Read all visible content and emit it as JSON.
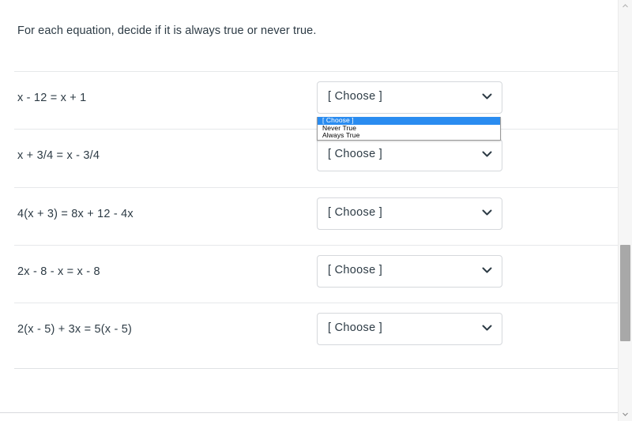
{
  "prompt": "For each equation, decide if it is always true or never true.",
  "select_placeholder": "[ Choose ]",
  "colors": {
    "highlight": "#2a8cf0",
    "text": "#2d3b45",
    "border": "#d5d8dc",
    "divider": "#e6e8ea",
    "scrollbar_thumb": "#a8a8a8"
  },
  "dropdown_options": [
    {
      "label": "[ Choose ]",
      "selected": true
    },
    {
      "label": "Never True",
      "selected": false
    },
    {
      "label": "Always True",
      "selected": false
    }
  ],
  "questions": [
    {
      "equation": "x - 12 = x + 1",
      "answer": "[ Choose ]",
      "open": true
    },
    {
      "equation": "x + 3/4 = x - 3/4",
      "answer": "[ Choose ]",
      "open": false
    },
    {
      "equation": "4(x + 3) = 8x + 12 - 4x",
      "answer": "[ Choose ]",
      "open": false
    },
    {
      "equation": "2x - 8 - x = x - 8",
      "answer": "[ Choose ]",
      "open": false
    },
    {
      "equation": "2(x - 5) + 3x = 5(x - 5)",
      "answer": "[ Choose ]",
      "open": false
    }
  ]
}
